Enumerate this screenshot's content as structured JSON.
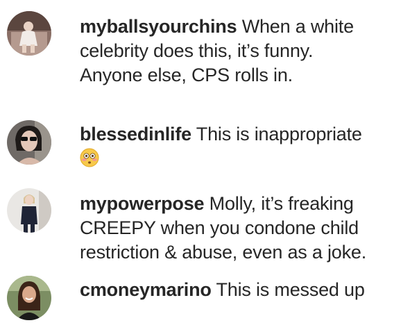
{
  "comments": [
    {
      "username": "myballsyourchins",
      "lines": [
        "When a white",
        "celebrity does this, it’s funny.",
        "Anyone else, CPS rolls in."
      ],
      "avatar_icon": "avatar-photo-child-on-sofa"
    },
    {
      "username": "blessedinlife",
      "lines": [
        "This is inappropriate"
      ],
      "emoji": "😳",
      "emoji_icon": "flushed-face-icon",
      "avatar_icon": "avatar-photo-woman-sunglasses"
    },
    {
      "username": "mypowerpose",
      "lines": [
        "Molly, it’s freaking",
        "CREEPY when you condone child",
        "restriction & abuse, even as a joke."
      ],
      "avatar_icon": "avatar-photo-woman-standing"
    },
    {
      "username": "cmoneymarino",
      "lines": [
        "This is messed up"
      ],
      "avatar_icon": "avatar-photo-woman-smiling"
    }
  ],
  "colors": {
    "text": "#262626",
    "background": "#ffffff"
  }
}
